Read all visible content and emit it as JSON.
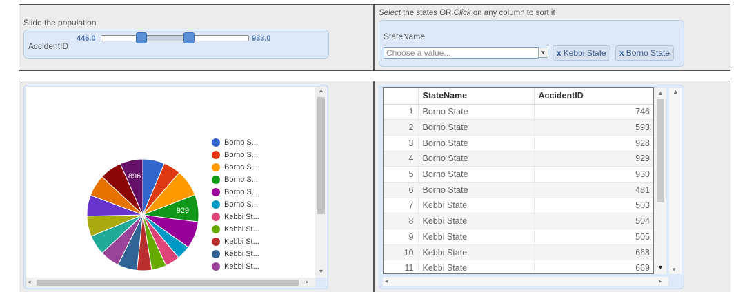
{
  "slider_panel": {
    "title": "Slide the population",
    "label": "AccidentID",
    "min_value": "446.0",
    "max_value": "933.0",
    "low_fraction": 0.27,
    "high_fraction": 0.59
  },
  "filter_panel": {
    "instruction_select": "Select",
    "instruction_middle": " the states OR ",
    "instruction_click": "Click",
    "instruction_end": " on any column to sort it",
    "field_label": "StateName",
    "placeholder": "Choose a value...",
    "selected": [
      {
        "x": "x",
        "label": "Kebbi State"
      },
      {
        "x": "x",
        "label": "Borno State"
      }
    ]
  },
  "legend": {
    "items": [
      {
        "label": "Borno S...",
        "color": "#3366cc"
      },
      {
        "label": "Borno S...",
        "color": "#dc3912"
      },
      {
        "label": "Borno S...",
        "color": "#ff9900"
      },
      {
        "label": "Borno S...",
        "color": "#109618"
      },
      {
        "label": "Borno S...",
        "color": "#990099"
      },
      {
        "label": "Borno S...",
        "color": "#0099c6"
      },
      {
        "label": "Kebbi St...",
        "color": "#dd4477"
      },
      {
        "label": "Kebbi St...",
        "color": "#66aa00"
      },
      {
        "label": "Kebbi St...",
        "color": "#b82e2e"
      },
      {
        "label": "Kebbi St...",
        "color": "#316395"
      },
      {
        "label": "Kebbi St...",
        "color": "#994499"
      }
    ]
  },
  "chart_data": {
    "type": "pie",
    "slice_labels": [
      {
        "index": 3,
        "text": "929"
      },
      {
        "index": 20,
        "text": "896"
      }
    ],
    "slices": [
      {
        "value": 746,
        "color": "#3366cc"
      },
      {
        "value": 593,
        "color": "#dc3912"
      },
      {
        "value": 928,
        "color": "#ff9900"
      },
      {
        "value": 929,
        "color": "#109618"
      },
      {
        "value": 930,
        "color": "#990099"
      },
      {
        "value": 481,
        "color": "#0099c6"
      },
      {
        "value": 503,
        "color": "#dd4477"
      },
      {
        "value": 504,
        "color": "#66aa00"
      },
      {
        "value": 505,
        "color": "#b82e2e"
      },
      {
        "value": 668,
        "color": "#316395"
      },
      {
        "value": 669,
        "color": "#994499"
      },
      {
        "value": 680,
        "color": "#22aa99"
      },
      {
        "value": 700,
        "color": "#aaaa11"
      },
      {
        "value": 720,
        "color": "#6633cc"
      },
      {
        "value": 740,
        "color": "#e67300"
      },
      {
        "value": 760,
        "color": "#8b0707"
      },
      {
        "value": 780,
        "color": "#651067"
      }
    ],
    "slice_order_note": ""
  },
  "table": {
    "columns": [
      "StateName",
      "AccidentID"
    ],
    "rows": [
      {
        "n": "1",
        "state": "Borno State",
        "id": "746"
      },
      {
        "n": "2",
        "state": "Borno State",
        "id": "593"
      },
      {
        "n": "3",
        "state": "Borno State",
        "id": "928"
      },
      {
        "n": "4",
        "state": "Borno State",
        "id": "929"
      },
      {
        "n": "5",
        "state": "Borno State",
        "id": "930"
      },
      {
        "n": "6",
        "state": "Borno State",
        "id": "481"
      },
      {
        "n": "7",
        "state": "Kebbi State",
        "id": "503"
      },
      {
        "n": "8",
        "state": "Kebbi State",
        "id": "504"
      },
      {
        "n": "9",
        "state": "Kebbi State",
        "id": "505"
      },
      {
        "n": "10",
        "state": "Kebbi State",
        "id": "668"
      },
      {
        "n": "11",
        "state": "Kebbi State",
        "id": "669"
      }
    ]
  }
}
